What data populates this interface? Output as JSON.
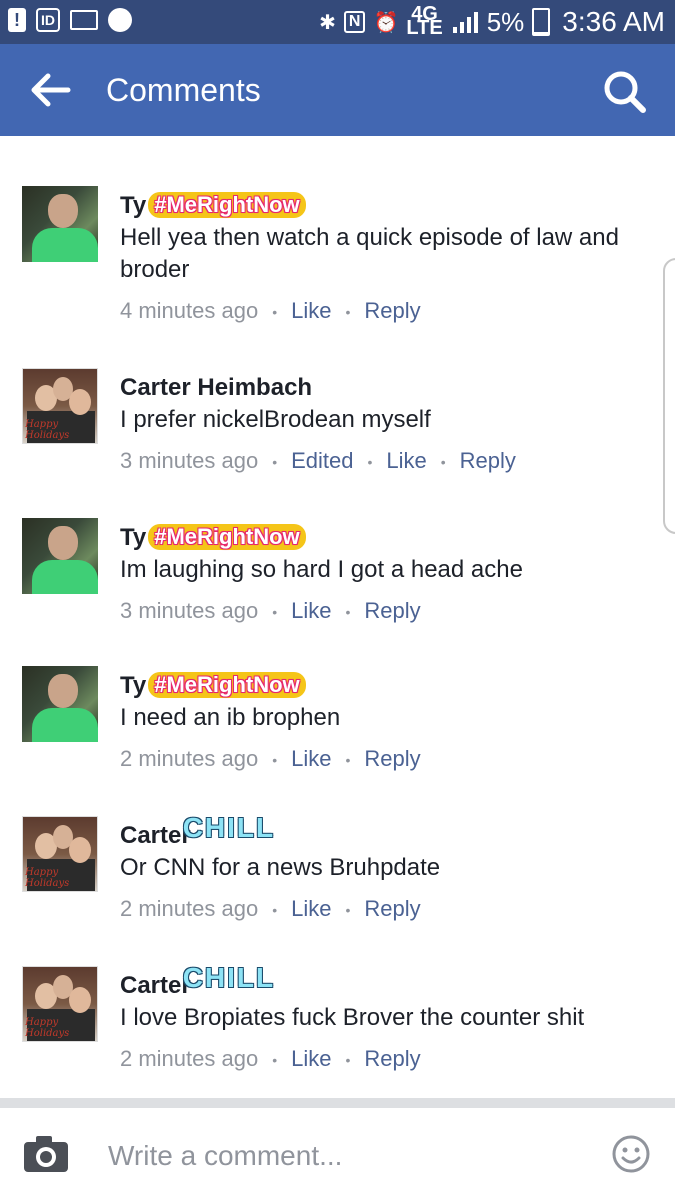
{
  "status_bar": {
    "exclamation": "!",
    "id_badge": "ID",
    "network": "4G",
    "network_sub": "LTE",
    "battery_pct": "5%",
    "time": "3:36 AM",
    "icons": [
      "alert-icon",
      "id-icon",
      "mail-icon",
      "messenger-icon",
      "bluetooth-icon",
      "nfc-icon",
      "alarm-icon",
      "signal-icon",
      "battery-icon"
    ]
  },
  "app_bar": {
    "title": "Comments",
    "back_icon": "arrow-left-icon",
    "search_icon": "search-icon",
    "color": "#4267b2"
  },
  "comments": [
    {
      "author": "Ty",
      "avatar": "ty",
      "name_frame": "#MeRightNow",
      "text": "Hell yea then watch a quick episode of law and broder",
      "time": "4 minutes ago",
      "actions": [
        "Like",
        "Reply"
      ]
    },
    {
      "author": "Carter Heimbach",
      "avatar": "carter",
      "avatar_caption": "Happy Holidays",
      "name_frame": "",
      "text": "I prefer nickelBrodean myself",
      "time": "3 minutes ago",
      "actions": [
        "Edited",
        "Like",
        "Reply"
      ]
    },
    {
      "author": "Ty",
      "avatar": "ty",
      "name_frame": "#MeRightNow",
      "text": "Im laughing so hard I got a head ache",
      "time": "3 minutes ago",
      "actions": [
        "Like",
        "Reply"
      ]
    },
    {
      "author": "Ty",
      "avatar": "ty",
      "name_frame": "#MeRightNow",
      "text": "I need an ib brophen",
      "time": "2 minutes ago",
      "actions": [
        "Like",
        "Reply"
      ]
    },
    {
      "author": "Carter",
      "avatar": "carter",
      "avatar_caption": "Happy Holidays",
      "name_frame": "CHILL",
      "text": "Or CNN for a news Bruhpdate",
      "time": "2 minutes ago",
      "actions": [
        "Like",
        "Reply"
      ]
    },
    {
      "author": "Carter",
      "avatar": "carter",
      "avatar_caption": "Happy Holidays",
      "name_frame": "CHILL",
      "text": "I love Bropiates  fuck Brover the counter shit",
      "time": "2 minutes ago",
      "actions": [
        "Like",
        "Reply"
      ]
    }
  ],
  "composer": {
    "placeholder": "Write a comment...",
    "camera_icon": "camera-icon",
    "emoji_icon": "emoji-icon"
  }
}
